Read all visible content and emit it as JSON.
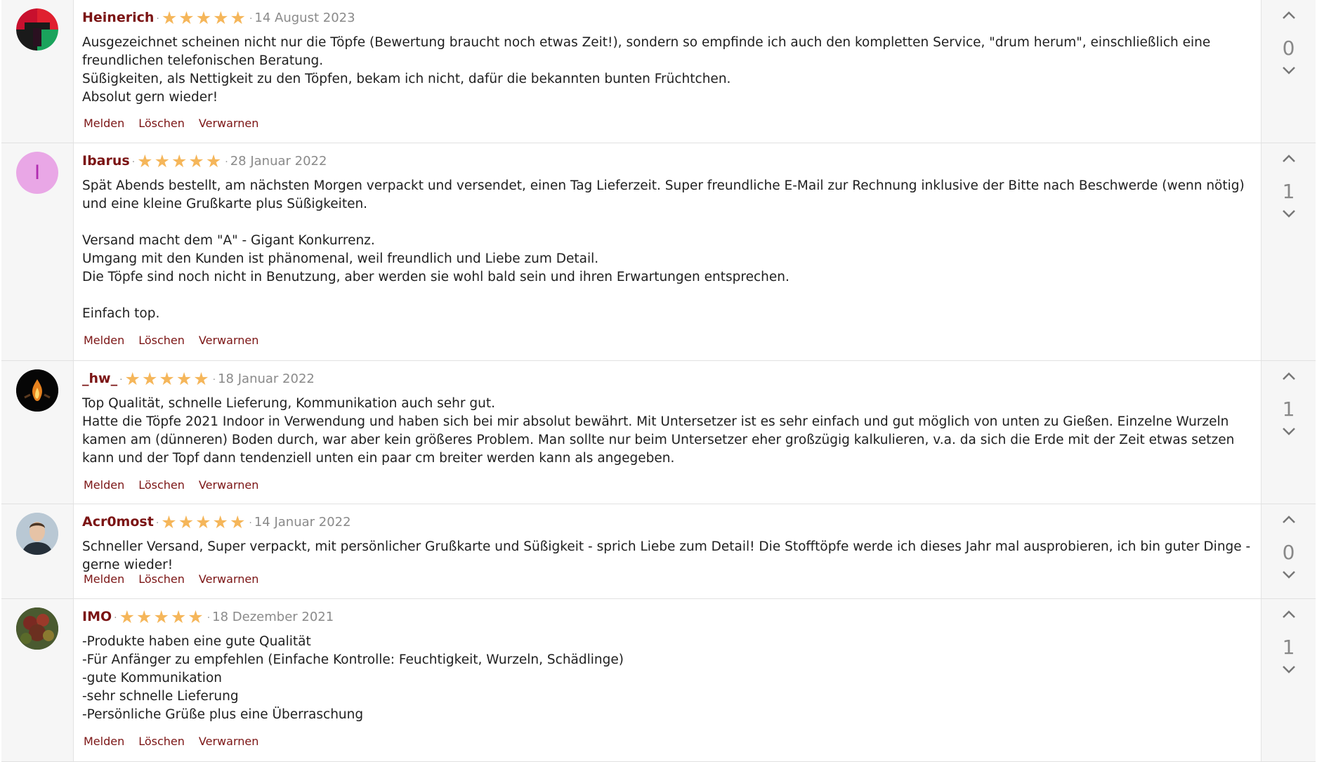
{
  "reviews": [
    {
      "author": "Heinerich",
      "rating": 5,
      "date": "14 August 2023",
      "text": "Ausgezeichnet scheinen nicht nur die Töpfe (Bewertung braucht noch etwas Zeit!), sondern so empfinde ich auch den kompletten Service, \"drum herum\", einschließlich eine freundlichen telefonischen Beratung.\nSüßigkeiten, als Nettigkeit zu den Töpfen, bekam ich nicht, dafür die bekannten bunten Früchtchen.\nAbsolut gern wieder!",
      "votes": "0",
      "avatar": "geometric-avatar"
    },
    {
      "author": "Ibarus",
      "rating": 5,
      "date": "28 Januar 2022",
      "text": "Spät Abends bestellt, am nächsten Morgen verpackt und versendet, einen Tag Lieferzeit. Super freundliche E-Mail zur Rechnung inklusive der Bitte nach Beschwerde (wenn nötig) und eine kleine Grußkarte plus Süßigkeiten.\n\nVersand macht dem \"A\" - Gigant Konkurrenz.\nUmgang mit den Kunden ist phänomenal, weil freundlich und Liebe zum Detail.\nDie Töpfe sind noch nicht in Benutzung, aber werden sie wohl bald sein und ihren Erwartungen entsprechen.\n\nEinfach top.",
      "votes": "1",
      "avatar": "letter-avatar",
      "avatar_letter": "I"
    },
    {
      "author": "_hw_",
      "rating": 5,
      "date": "18 Januar 2022",
      "text": "Top Qualität, schnelle Lieferung, Kommunikation auch sehr gut.\nHatte die Töpfe 2021 Indoor in Verwendung und haben sich bei mir absolut bewährt. Mit Untersetzer ist es sehr einfach und gut möglich von unten zu Gießen. Einzelne Wurzeln kamen am (dünneren) Boden durch, war aber kein größeres Problem. Man sollte nur beim Untersetzer eher großzügig kalkulieren, v.a. da sich die Erde mit der Zeit etwas setzen kann und der Topf dann tendenziell unten ein paar cm breiter werden kann als angegeben.",
      "votes": "1",
      "avatar": "flame-avatar"
    },
    {
      "author": "Acr0most",
      "rating": 5,
      "date": "14 Januar 2022",
      "text": "Schneller Versand, Super verpackt, mit persönlicher Grußkarte und Süßigkeit - sprich Liebe zum Detail! Die Stofftöpfe werde ich dieses Jahr mal ausprobieren, ich bin guter Dinge - gerne wieder!",
      "votes": "0",
      "avatar": "portrait-avatar"
    },
    {
      "author": "IMO",
      "rating": 5,
      "date": "18 Dezember 2021",
      "text": "-Produkte haben eine gute Qualität\n-Für Anfänger zu empfehlen (Einfache Kontrolle: Feuchtigkeit, Wurzeln, Schädlinge)\n-gute Kommunikation\n-sehr schnelle Lieferung\n-Persönliche Grüße plus eine Überraschung",
      "votes": "1",
      "avatar": "plant-avatar"
    }
  ],
  "actions": {
    "report": "Melden",
    "delete": "Löschen",
    "warn": "Verwarnen"
  },
  "colors": {
    "author": "#7b1414",
    "star": "#f5b65a",
    "action": "#7b1414",
    "panel": "#f6f6f6"
  },
  "icons": {
    "upvote": "chevron-up-icon",
    "downvote": "chevron-down-icon",
    "star": "star-icon"
  }
}
